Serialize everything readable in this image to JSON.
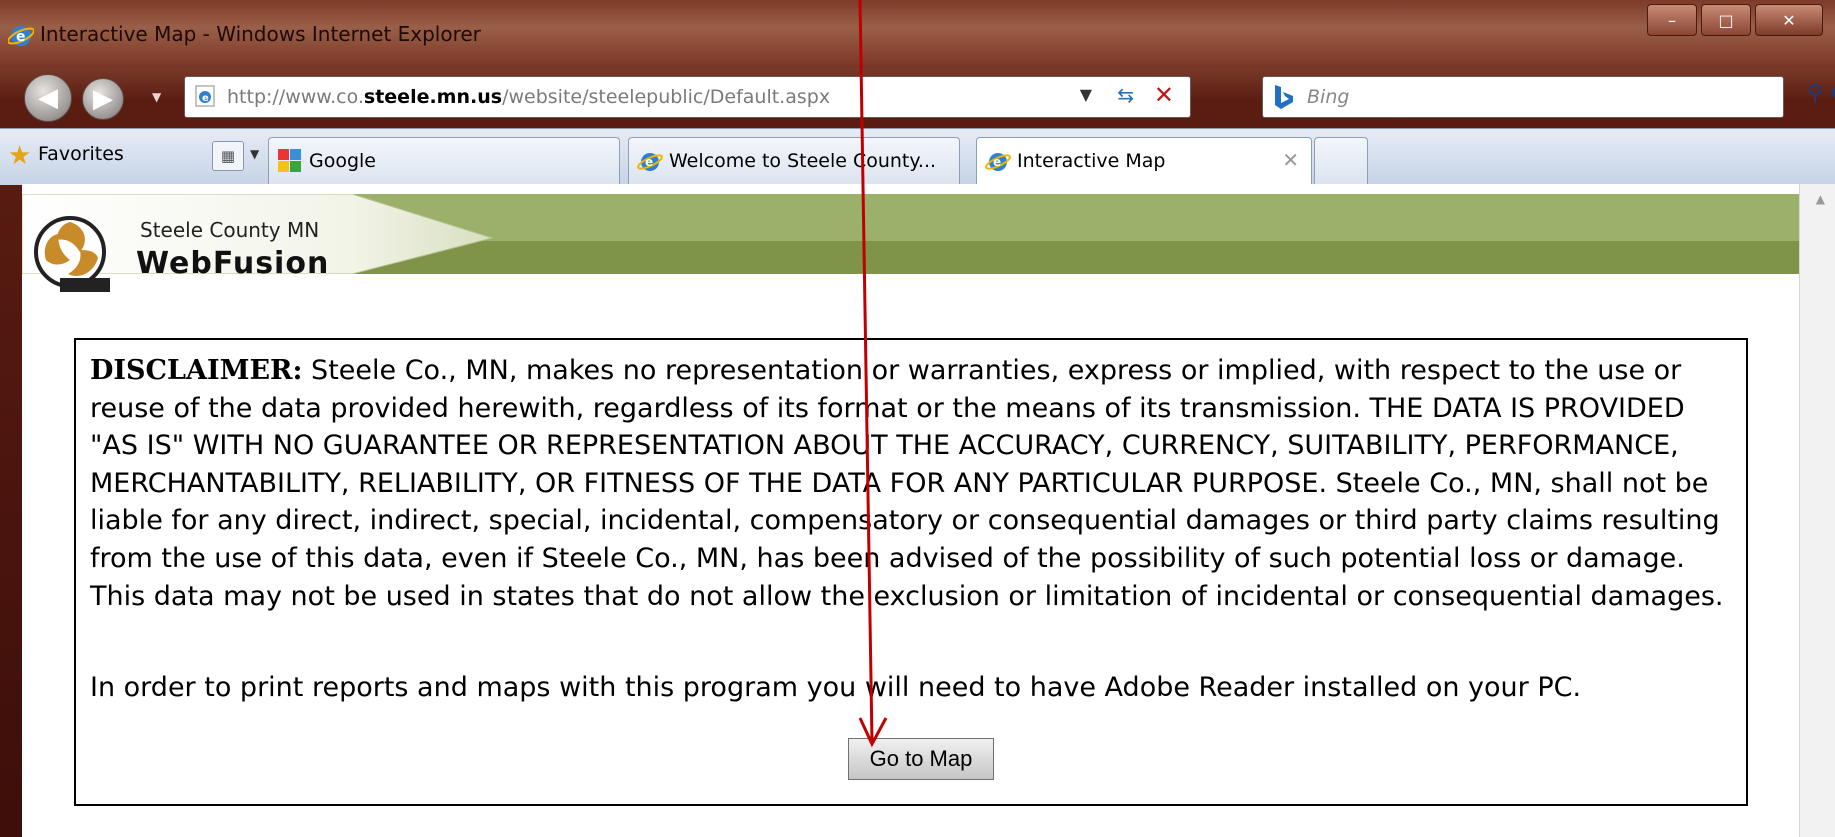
{
  "window": {
    "title": "Interactive Map - Windows Internet Explorer",
    "controls": {
      "minimize": "–",
      "maximize": "□",
      "close": "✕"
    }
  },
  "navigation": {
    "address_prefix": "http://www.co.",
    "address_domain": "steele.mn.us",
    "address_path": "/website/steelepublic/Default.aspx",
    "search_placeholder": "Bing"
  },
  "favorites_bar": {
    "favorites_label": "Favorites",
    "tabs": [
      {
        "label": "Google",
        "icon": "google-icon"
      },
      {
        "label": "Welcome to Steele County...",
        "icon": "ie-icon"
      },
      {
        "label": "Interactive Map",
        "icon": "ie-icon",
        "active": true
      }
    ]
  },
  "page": {
    "org_name": "Steele County MN",
    "brand": "WebFusion",
    "disclaimer_label": "DISCLAIMER:",
    "disclaimer_text": " Steele Co., MN, makes no representation or warranties, express or implied, with respect to the use or reuse of the data provided herewith, regardless of its format or the means of its transmission. THE DATA IS PROVIDED \"AS IS\" WITH NO GUARANTEE OR REPRESENTATION ABOUT THE ACCURACY, CURRENCY, SUITABILITY, PERFORMANCE, MERCHANTABILITY, RELIABILITY, OR FITNESS OF THE DATA FOR ANY PARTICULAR PURPOSE. Steele Co., MN, shall not be liable for any direct, indirect, special, incidental, compensatory or consequential damages or third party claims resulting from the use of this data, even if Steele Co., MN, has been advised of the possibility of such potential loss or damage. This data may not be used in states that do not allow the exclusion or limitation of incidental or consequential damages.",
    "print_note": "In order to print reports and maps with this program you will need to have Adobe Reader installed on your PC.",
    "go_button": "Go to Map"
  },
  "colors": {
    "header_green_light": "#9bb06a",
    "header_green_dark": "#7f9448",
    "annotation_arrow": "#c00000"
  }
}
